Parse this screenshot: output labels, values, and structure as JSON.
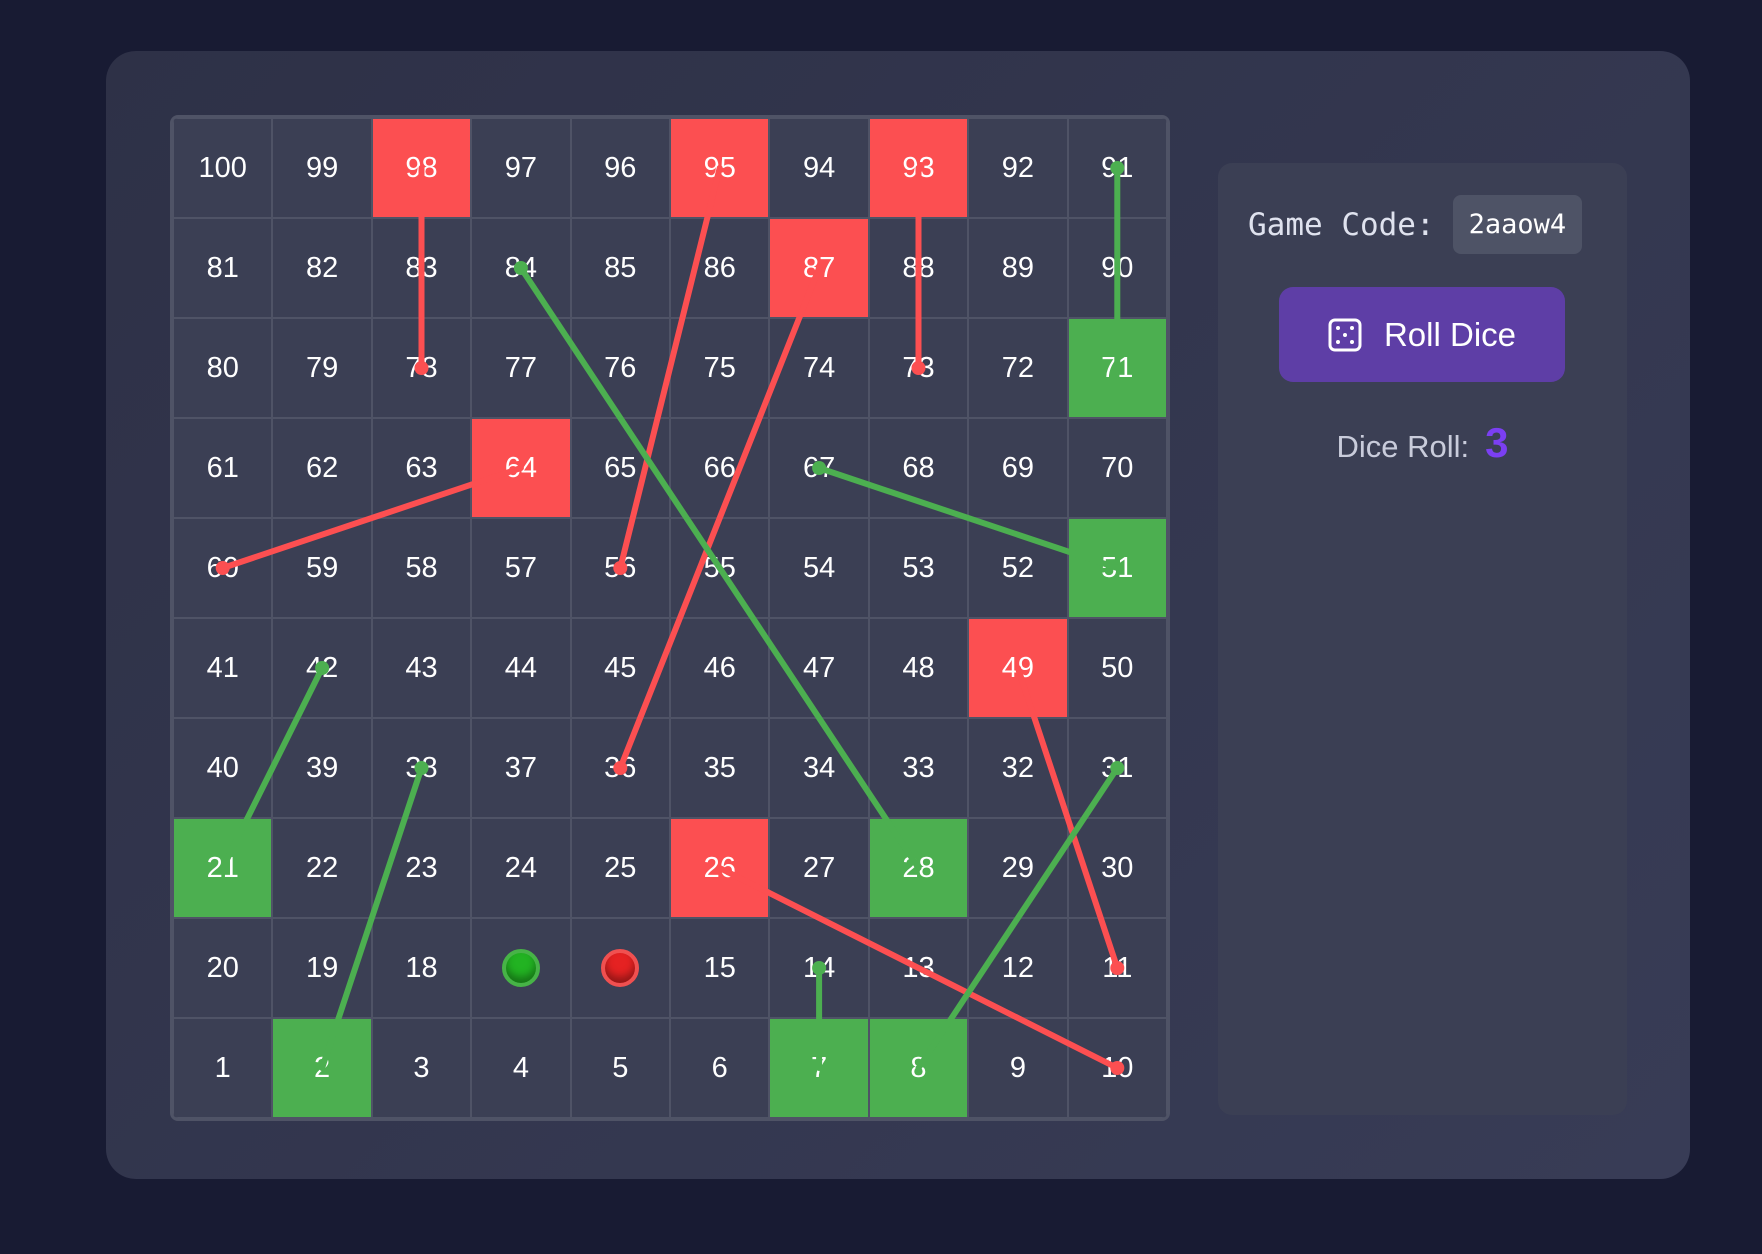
{
  "board": {
    "rows": [
      [
        100,
        99,
        98,
        97,
        96,
        95,
        94,
        93,
        92,
        91
      ],
      [
        81,
        82,
        83,
        84,
        85,
        86,
        87,
        88,
        89,
        90
      ],
      [
        80,
        79,
        78,
        77,
        76,
        75,
        74,
        73,
        72,
        71
      ],
      [
        61,
        62,
        63,
        64,
        65,
        66,
        67,
        68,
        69,
        70
      ],
      [
        60,
        59,
        58,
        57,
        56,
        55,
        54,
        53,
        52,
        51
      ],
      [
        41,
        42,
        43,
        44,
        45,
        46,
        47,
        48,
        49,
        50
      ],
      [
        40,
        39,
        38,
        37,
        36,
        35,
        34,
        33,
        32,
        31
      ],
      [
        21,
        22,
        23,
        24,
        25,
        26,
        27,
        28,
        29,
        30
      ],
      [
        20,
        19,
        18,
        17,
        16,
        15,
        14,
        13,
        12,
        11
      ],
      [
        1,
        2,
        3,
        4,
        5,
        6,
        7,
        8,
        9,
        10
      ]
    ],
    "snakes": [
      {
        "from": 98,
        "to": 78
      },
      {
        "from": 95,
        "to": 56
      },
      {
        "from": 93,
        "to": 73
      },
      {
        "from": 87,
        "to": 36
      },
      {
        "from": 64,
        "to": 60
      },
      {
        "from": 49,
        "to": 11
      },
      {
        "from": 26,
        "to": 10
      }
    ],
    "ladders": [
      {
        "from": 71,
        "to": 91
      },
      {
        "from": 51,
        "to": 67
      },
      {
        "from": 28,
        "to": 84
      },
      {
        "from": 21,
        "to": 42
      },
      {
        "from": 2,
        "to": 38
      },
      {
        "from": 7,
        "to": 14
      },
      {
        "from": 8,
        "to": 31
      }
    ],
    "tokens": [
      {
        "cell": 17,
        "color": "#22b322",
        "name": "green-player-token"
      },
      {
        "cell": 16,
        "color": "#e52222",
        "name": "red-player-token"
      }
    ],
    "colors": {
      "snake": "#fc4f51",
      "ladder": "#4caf50",
      "cell": "#3b3f54"
    }
  },
  "sidebar": {
    "game_code_label": "Game Code:",
    "game_code": "2aaow4",
    "roll_button_label": "Roll Dice",
    "roll_button_icon": "dice-icon",
    "dice_roll_label": "Dice Roll:",
    "dice_roll_value": "3"
  }
}
